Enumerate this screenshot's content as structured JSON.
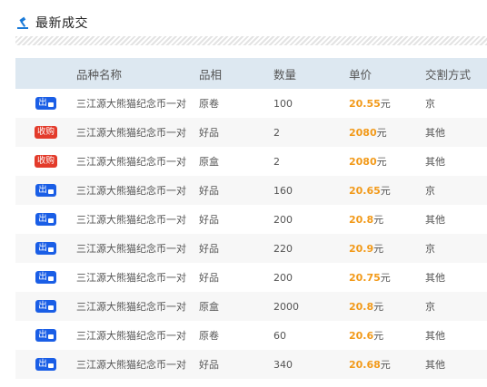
{
  "header": {
    "title": "最新成交",
    "icon": "auction-hammer-icon"
  },
  "table": {
    "columns": [
      "品种名称",
      "品相",
      "数量",
      "单价",
      "交割方式"
    ],
    "rows": [
      {
        "type": "出",
        "badge_icon": "lock-icon",
        "name": "三江源大熊猫纪念币一对",
        "condition": "原卷",
        "quantity": "100",
        "price": "20.55",
        "unit": "元",
        "method": "京"
      },
      {
        "type": "收购",
        "badge_icon": "",
        "name": "三江源大熊猫纪念币一对",
        "condition": "好品",
        "quantity": "2",
        "price": "2080",
        "unit": "元",
        "method": "其他"
      },
      {
        "type": "收购",
        "badge_icon": "",
        "name": "三江源大熊猫纪念币一对",
        "condition": "原盒",
        "quantity": "2",
        "price": "2080",
        "unit": "元",
        "method": "其他"
      },
      {
        "type": "出",
        "badge_icon": "lock-icon",
        "name": "三江源大熊猫纪念币一对",
        "condition": "好品",
        "quantity": "160",
        "price": "20.65",
        "unit": "元",
        "method": "京"
      },
      {
        "type": "出",
        "badge_icon": "lock-icon",
        "name": "三江源大熊猫纪念币一对",
        "condition": "好品",
        "quantity": "200",
        "price": "20.8",
        "unit": "元",
        "method": "其他"
      },
      {
        "type": "出",
        "badge_icon": "lock-icon",
        "name": "三江源大熊猫纪念币一对",
        "condition": "好品",
        "quantity": "220",
        "price": "20.9",
        "unit": "元",
        "method": "京"
      },
      {
        "type": "出",
        "badge_icon": "lock-icon",
        "name": "三江源大熊猫纪念币一对",
        "condition": "好品",
        "quantity": "200",
        "price": "20.75",
        "unit": "元",
        "method": "其他"
      },
      {
        "type": "出",
        "badge_icon": "lock-icon",
        "name": "三江源大熊猫纪念币一对",
        "condition": "原盒",
        "quantity": "2000",
        "price": "20.8",
        "unit": "元",
        "method": "京"
      },
      {
        "type": "出",
        "badge_icon": "lock-icon",
        "name": "三江源大熊猫纪念币一对",
        "condition": "原卷",
        "quantity": "60",
        "price": "20.6",
        "unit": "元",
        "method": "其他"
      },
      {
        "type": "出",
        "badge_icon": "lock-icon",
        "name": "三江源大熊猫纪念币一对",
        "condition": "好品",
        "quantity": "340",
        "price": "20.68",
        "unit": "元",
        "method": "其他"
      }
    ]
  },
  "colors": {
    "sell_badge": "#1a5ee6",
    "buy_badge": "#e33b2b",
    "price": "#f29a1a",
    "header_bg": "#dde8f1"
  }
}
